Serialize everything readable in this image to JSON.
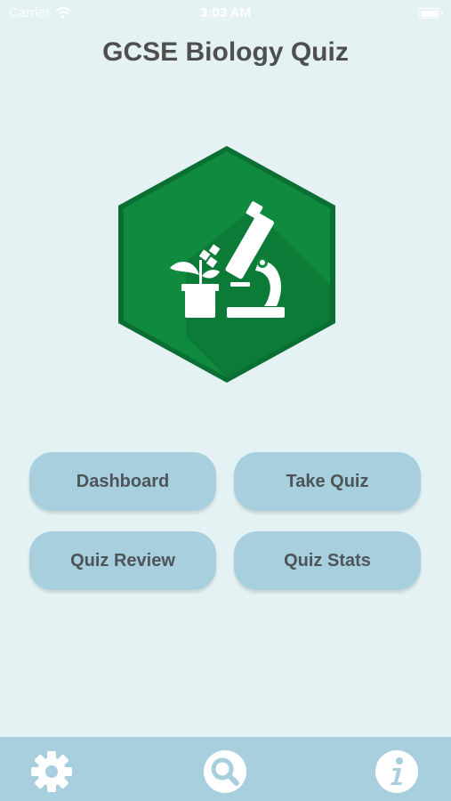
{
  "status_bar": {
    "carrier": "Carrier",
    "time": "3:03 AM"
  },
  "header": {
    "title": "GCSE Biology Quiz"
  },
  "logo": {
    "icon": "microscope-plant-icon",
    "color": "#0f8a3f"
  },
  "menu": {
    "buttons": [
      {
        "label": "Dashboard"
      },
      {
        "label": "Take Quiz"
      },
      {
        "label": "Quiz Review"
      },
      {
        "label": "Quiz Stats"
      }
    ]
  },
  "tab_bar": {
    "icons": [
      "gear-icon",
      "search-icon",
      "info-icon"
    ]
  },
  "colors": {
    "background": "#e4f2f4",
    "button": "#a8cfdd",
    "button_text": "#4e5559",
    "title_text": "#4f4f4f",
    "brand_green": "#0f8a3f"
  }
}
